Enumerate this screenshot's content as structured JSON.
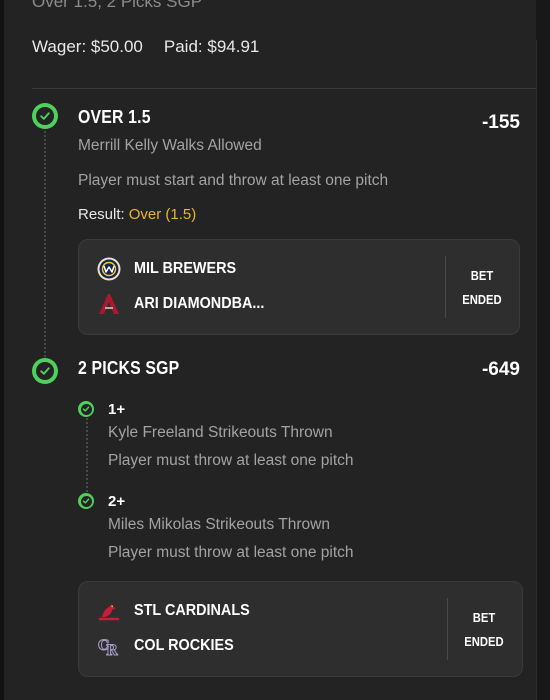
{
  "header": {
    "subtitle": "Over 1.5, 2 Picks SGP",
    "wager": "Wager: $50.00",
    "paid": "Paid: $94.91"
  },
  "legs": [
    {
      "title": "OVER 1.5",
      "odds": "-155",
      "market": "Merrill Kelly Walks Allowed",
      "rule": "Player must start and throw at least one pitch",
      "result_label": "Result:",
      "result_value": "Over (1.5)",
      "game": {
        "team1": "MIL BREWERS",
        "team2": "ARI DIAMONDBA...",
        "status_line1": "BET",
        "status_line2": "ENDED"
      }
    },
    {
      "title": "2 PICKS SGP",
      "odds": "-649",
      "picks": [
        {
          "title": "1+",
          "market": "Kyle Freeland Strikeouts Thrown",
          "rule": "Player must throw at least one pitch"
        },
        {
          "title": "2+",
          "market": "Miles Mikolas Strikeouts Thrown",
          "rule": "Player must throw at least one pitch"
        }
      ],
      "game": {
        "team1": "STL CARDINALS",
        "team2": "COL ROCKIES",
        "status_line1": "BET",
        "status_line2": "ENDED"
      }
    }
  ],
  "icons": {
    "check": "check-circle-icon",
    "team_logos": [
      "brewers-logo-icon",
      "diamondbacks-logo-icon",
      "cardinals-logo-icon",
      "rockies-logo-icon"
    ]
  },
  "colors": {
    "success_green": "#4fd05c",
    "result_gold": "#e8b730",
    "card_bg": "#232323",
    "game_card_bg": "#2e2e2e"
  }
}
